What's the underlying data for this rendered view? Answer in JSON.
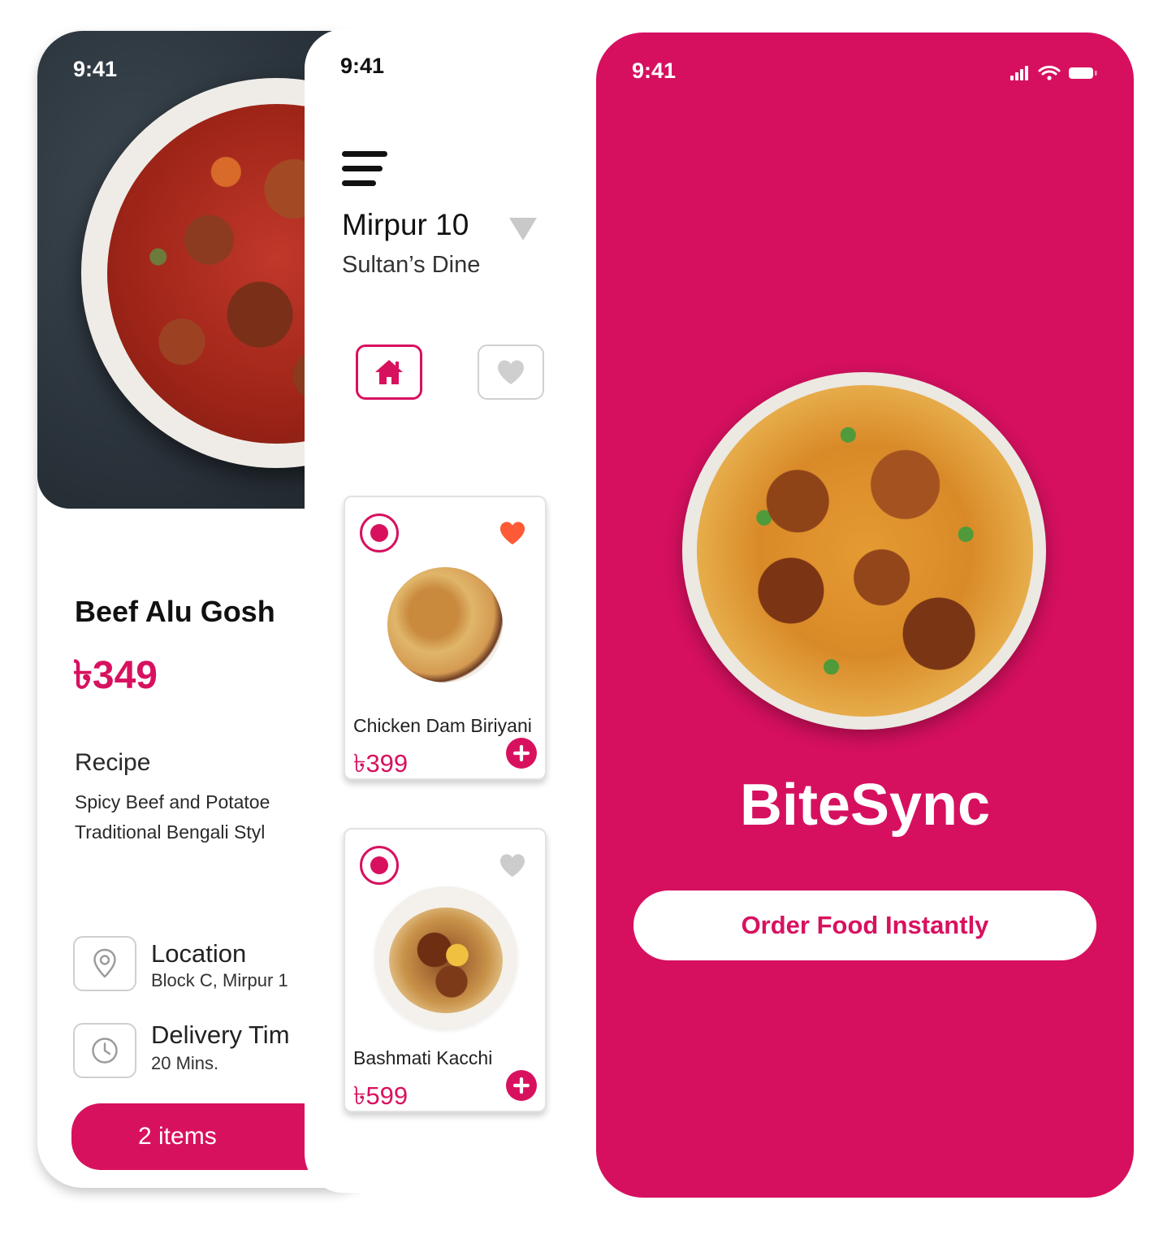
{
  "colors": {
    "brand": "#d8115f",
    "brand_splash": "#d6105f",
    "heart_active": "#ff5a36",
    "heart_inactive": "#cccccc"
  },
  "detail_screen": {
    "status_time": "9:41",
    "dish_name": "Beef Alu Gosh",
    "price": "৳349",
    "recipe_heading": "Recipe",
    "recipe_line1": "Spicy Beef and Potatoe",
    "recipe_line2": "Traditional Bengali Styl",
    "location": {
      "title": "Location",
      "value": "Block C, Mirpur 1",
      "icon": "location-pin-icon"
    },
    "delivery": {
      "title": "Delivery Tim",
      "value": "20 Mins.",
      "icon": "clock-icon"
    },
    "cart_label": "2 items"
  },
  "menu_screen": {
    "status_time": "9:41",
    "menu_icon": "hamburger-menu-icon",
    "location": "Mirpur 10",
    "restaurant": "Sultan’s Dine",
    "tabs": [
      {
        "name": "home",
        "icon": "home-icon",
        "active": true
      },
      {
        "name": "favorites",
        "icon": "heart-icon",
        "active": false
      }
    ],
    "items": [
      {
        "name": "Chicken Dam Biriyani",
        "price": "৳399",
        "favorite": true
      },
      {
        "name": "Bashmati Kacchi",
        "price": "৳599",
        "favorite": false
      }
    ]
  },
  "splash_screen": {
    "status_time": "9:41",
    "status_icons": [
      "signal-icon",
      "wifi-icon",
      "battery-icon"
    ],
    "app_name": "BiteSync",
    "cta": "Order Food Instantly"
  }
}
